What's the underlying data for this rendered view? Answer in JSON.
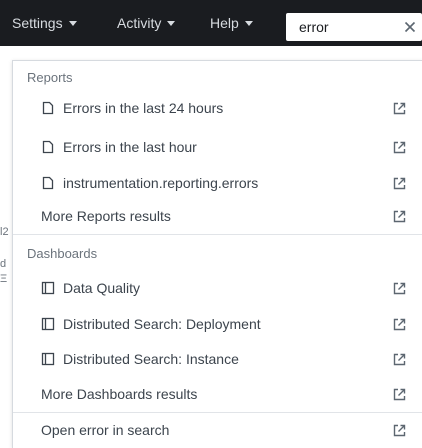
{
  "nav": {
    "settings": "Settings",
    "activity": "Activity",
    "help": "Help"
  },
  "search": {
    "value": "error"
  },
  "icons": {
    "caret": "caret-down-icon",
    "clear": "close-icon",
    "report": "document-icon",
    "dashboard": "dashboard-icon",
    "external": "external-link-icon"
  },
  "background_fragments": [
    "l2",
    "d",
    "Ξ"
  ],
  "dropdown": {
    "reports": {
      "header": "Reports",
      "items": [
        "Errors in the last 24 hours",
        "Errors in the last hour",
        "instrumentation.reporting.errors"
      ],
      "more": "More Reports results"
    },
    "dashboards": {
      "header": "Dashboards",
      "items": [
        "Data Quality",
        "Distributed Search: Deployment",
        "Distributed Search: Instance"
      ],
      "more": "More Dashboards results"
    },
    "open_search": "Open error in search"
  },
  "colors": {
    "topbar": "#1a1c20",
    "text": "#3c444d",
    "muted": "#6b737c"
  }
}
